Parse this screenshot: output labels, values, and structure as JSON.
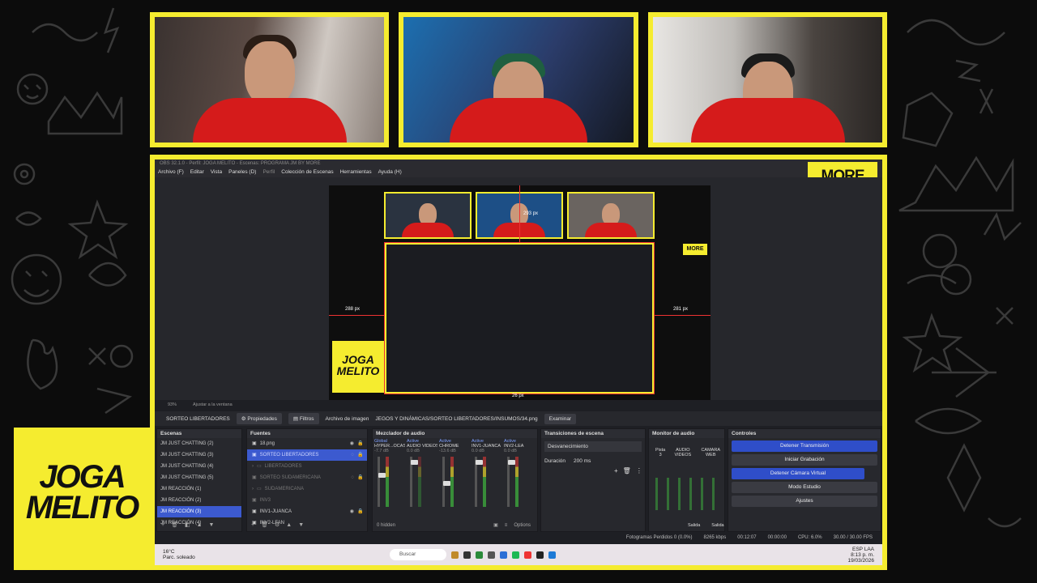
{
  "obs": {
    "window_title": "OBS 32.1.0 - Perfil: JOGA MELITO - Escenas: PROGRAMA JM BY MORE",
    "menu": [
      "Archivo (F)",
      "Editar",
      "Vista",
      "Paneles (D)",
      "Perfil",
      "Colección de Escenas",
      "Herramientas",
      "Ayuda (H)"
    ],
    "preview": {
      "guides": {
        "top": "293 px",
        "left": "288 px",
        "right": "281 px",
        "bottom": "26 px"
      }
    },
    "zoom": {
      "value": "93%",
      "mode": "Ajustar a la ventana"
    },
    "source_bar": {
      "selected_source": "SORTEO LIBERTADORES",
      "properties_label": "Propiedades",
      "filters_label": "Filtros",
      "image_file_label": "Archivo de imagen",
      "image_path": "JEGOS Y DINÁMICAS/SORTEO LIBERTADORES/INSUMOS/34.png",
      "browse_label": "Examinar"
    },
    "scenes": {
      "title": "Escenas",
      "items": [
        "JM JUST CHATTING (2)",
        "JM JUST CHATTING (3)",
        "JM JUST CHATTING (4)",
        "JM JUST CHATTING (5)",
        "JM REACCIÓN (1)",
        "JM REACCIÓN (2)",
        "JM REACCIÓN (3)",
        "JM REACCIÓN (4)"
      ],
      "active_index": 6
    },
    "sources": {
      "title": "Fuentes",
      "items": [
        {
          "label": "18.png",
          "state": "normal"
        },
        {
          "label": "SORTEO LIBERTADORES",
          "state": "active"
        },
        {
          "label": "LIBERTADORES",
          "state": "dim"
        },
        {
          "label": "SORTEO SUDAMERICANA",
          "state": "dim"
        },
        {
          "label": "SUDAMERICANA",
          "state": "dim"
        },
        {
          "label": "INV3",
          "state": "dim"
        },
        {
          "label": "INV1-JUANCA",
          "state": "normal"
        },
        {
          "label": "INV2-LFAN",
          "state": "normal"
        }
      ]
    },
    "mixer": {
      "title": "Mezclador de audio",
      "channels": [
        {
          "tag": "Global",
          "name": "HYPER...OCAST",
          "db": "-7.7 dB"
        },
        {
          "tag": "Active",
          "name": "AUDIO VIDEOS",
          "db": "0.0 dB"
        },
        {
          "tag": "Active",
          "name": "CHROME",
          "db": "-13.6 dB"
        },
        {
          "tag": "Active",
          "name": "INV1-JUANCA",
          "db": "0.0 dB"
        },
        {
          "tag": "Active",
          "name": "INV2-LEA",
          "db": "0.0 dB"
        }
      ],
      "hidden_label": "0 hidden",
      "options_label": "Options"
    },
    "transitions": {
      "title": "Transiciones de escena",
      "selected": "Desvanecimiento",
      "duration_label": "Duración",
      "duration_value": "200 ms"
    },
    "monitor": {
      "title": "Monitor de audio",
      "tracks": [
        "Pista 3",
        "AUDIO VIDEOS",
        "CAMARA WEB"
      ],
      "out_labels": [
        "Salida",
        "Salida"
      ]
    },
    "controls": {
      "title": "Controles",
      "buttons": [
        "Detener Transmisión",
        "Iniciar Grabación",
        "Detener Cámara Virtual",
        "Modo Estudio",
        "Ajustes"
      ]
    },
    "status": {
      "dropped": "Fotogramas Perdidos 0 (0.0%)",
      "bitrate": "8265 kbps",
      "live_time": "00:12:07",
      "rec_time": "00:00:00",
      "cpu": "CPU: 6.0%",
      "fps": "30.00 / 30.00 FPS"
    },
    "taskbar": {
      "weather_temp": "16°C",
      "weather_desc": "Parc. soleado",
      "search": "Buscar",
      "lang": "ESP LAA",
      "time": "8:13 p. m.",
      "date": "19/03/2026"
    }
  },
  "branding": {
    "more": "MORE",
    "logo_line1": "JOGA",
    "logo_line2": "MELITO"
  },
  "colors": {
    "accent_yellow": "#f5ec2f",
    "obs_blue": "#2f4ec9",
    "shirt_red": "#d51b1b"
  }
}
